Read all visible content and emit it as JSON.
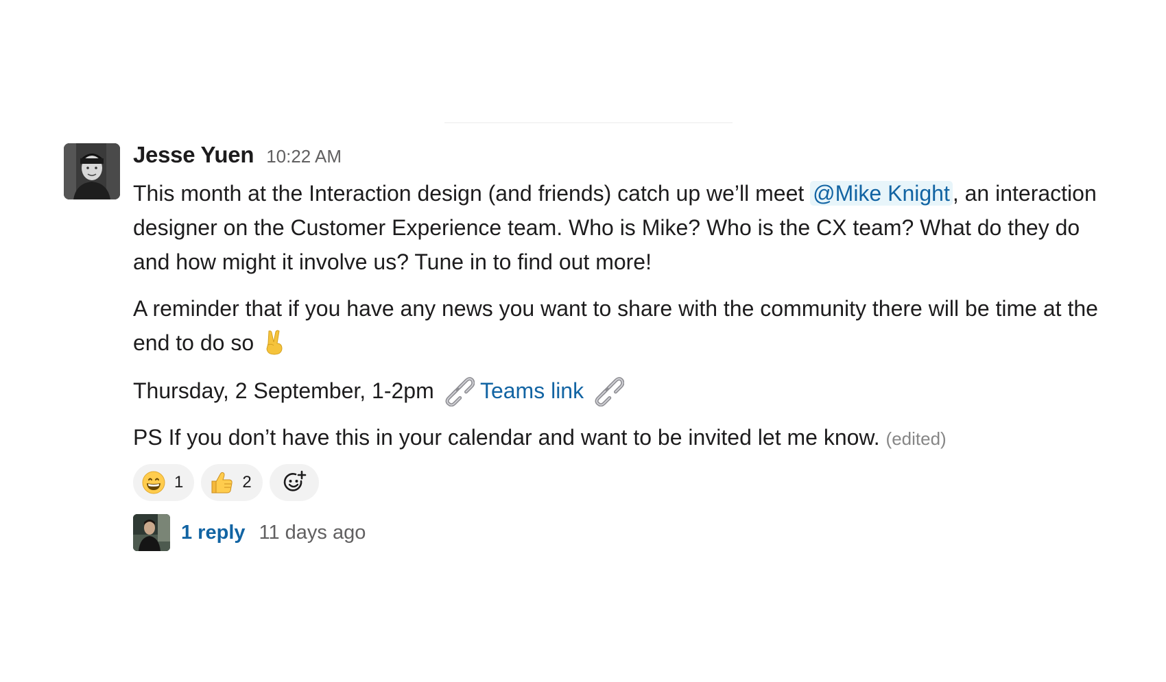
{
  "message": {
    "author": "Jesse Yuen",
    "timestamp": "10:22 AM",
    "p1_before": "This month at the Interaction design (and friends) catch up we’ll meet ",
    "mention": "@Mike Knight",
    "p1_after": ", an interaction designer on the Customer Experience team. Who is Mike? Who is the CX team? What do they do and how might it involve us? Tune in to find out more!",
    "p2": "A reminder that if you have any news you want to share with the community there will be time at the end to do so ",
    "p3_date": "Thursday, 2 September, 1-2pm ",
    "p3_link": "Teams link",
    "p4": "PS If you don’t have this in your calendar and want to be invited let me know. ",
    "edited": "(edited)",
    "icons": [
      "victory-hand-emoji",
      "link-emoji"
    ]
  },
  "reactions": [
    {
      "emoji": "grinning-face-emoji",
      "count": "1"
    },
    {
      "emoji": "thumbs-up-emoji",
      "count": "2"
    },
    {
      "emoji": "add-reaction-icon",
      "count": ""
    }
  ],
  "thread": {
    "reply_count": "1 reply",
    "last_reply": "11 days ago"
  },
  "colors": {
    "link": "#1264a3",
    "mention_bg": "#e8f5fa",
    "text": "#1d1c1d",
    "muted": "#616061"
  }
}
